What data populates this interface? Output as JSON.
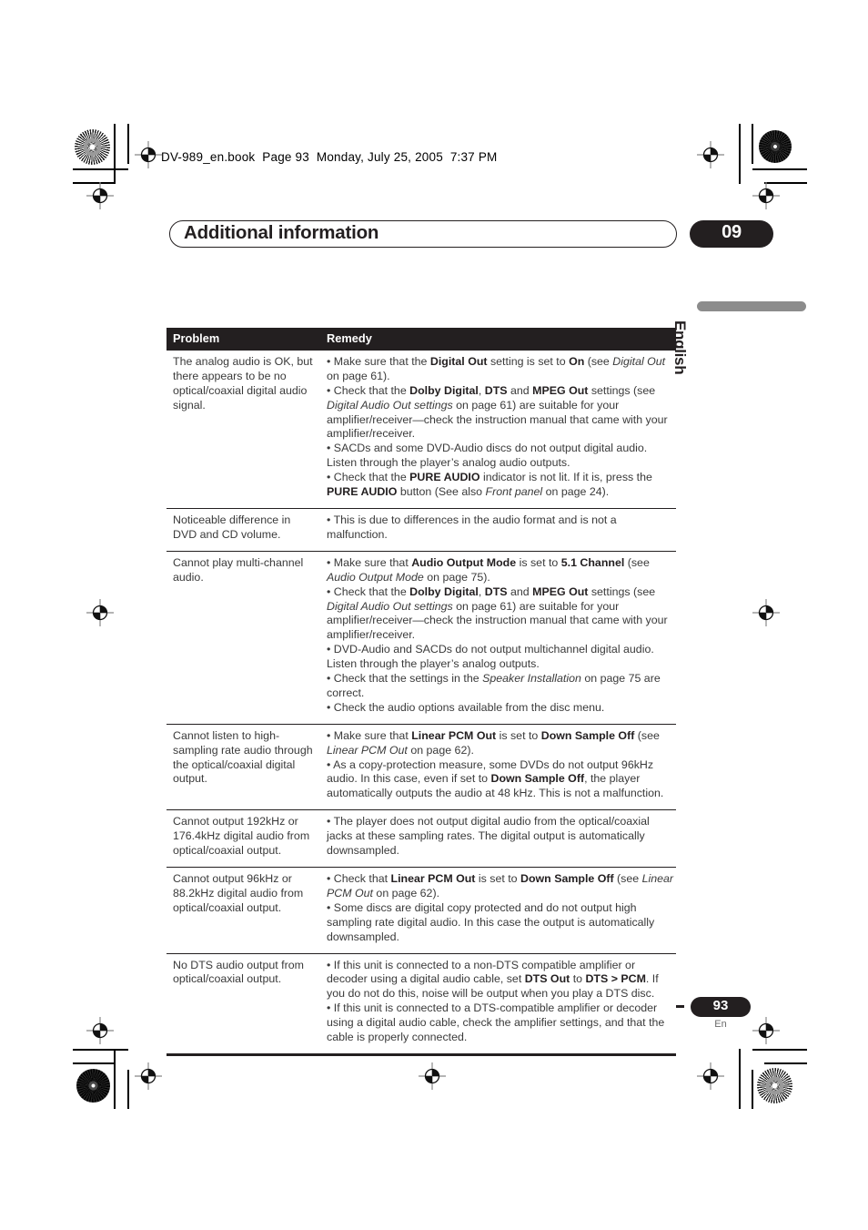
{
  "running_header": "DV-989_en.book  Page 93  Monday, July 25, 2005  7:37 PM",
  "section": {
    "title": "Additional information",
    "chapter_number": "09"
  },
  "side_tab": {
    "language": "English",
    "bar_color": "#8c8c8c"
  },
  "table": {
    "headers": {
      "problem": "Problem",
      "remedy": "Remedy"
    },
    "rows": [
      {
        "problem": "The analog audio is OK, but there appears to be no optical/coaxial digital audio signal.",
        "remedy_html": "<span class=\"bul\">• Make sure that the <b>Digital Out</b> setting is set to <b>On</b> (see <i>Digital Out</i> on page 61).</span><span class=\"bul\">• Check that the <b>Dolby Digital</b>, <b>DTS</b> and <b>MPEG Out</b> settings (see <i>Digital Audio Out settings</i> on page 61) are suitable for your amplifier/receiver—check the instruction manual that came with your amplifier/receiver.</span><span class=\"bul\">• SACDs and some DVD-Audio discs do not output digital audio. Listen through the player&rsquo;s analog audio outputs.</span><span class=\"bul\">• Check that the <b>PURE AUDIO</b> indicator is not lit. If it is, press the <b>PURE AUDIO</b> button (See also <i>Front panel</i> on page 24).</span>"
      },
      {
        "problem": "Noticeable difference in DVD and CD volume.",
        "remedy_html": "<span class=\"bul\">• This is due to differences in the audio format and is not a malfunction.</span>"
      },
      {
        "problem": "Cannot play multi-channel audio.",
        "remedy_html": "<span class=\"bul\">• Make sure that <b>Audio Output Mode</b> is set to <b>5.1 Channel</b> (see <i>Audio Output Mode</i> on page 75).</span><span class=\"bul\">• Check that the <b>Dolby Digital</b>, <b>DTS</b> and <b>MPEG Out</b> settings (see <i>Digital Audio Out settings</i> on page 61) are suitable for your amplifier/receiver—check the instruction manual that came with your amplifier/receiver.</span><span class=\"bul\">• DVD-Audio and SACDs do not output multichannel digital audio. Listen through the player&rsquo;s analog outputs.</span><span class=\"bul\">• Check that the settings in the <i>Speaker Installation</i> on page 75 are correct.</span><span class=\"bul\">• Check the audio options available from the disc menu.</span>"
      },
      {
        "problem": "Cannot listen to high-sampling rate audio through the optical/coaxial digital output.",
        "remedy_html": "<span class=\"bul\">• Make sure that <b>Linear PCM Out</b> is set to <b>Down Sample Off</b> (see <i>Linear PCM Out</i> on page 62).</span><span class=\"bul\">• As a copy-protection measure, some DVDs do not output 96kHz audio. In this case, even if set to <b>Down Sample Off</b>, the player automatically outputs the audio at 48 kHz. This is not a malfunction.</span>"
      },
      {
        "problem": "Cannot output 192kHz or 176.4kHz digital audio from optical/coaxial output.",
        "remedy_html": "<span class=\"bul\">• The player does not output digital audio from the optical/coaxial jacks at these sampling rates. The digital output is automatically downsampled.</span>"
      },
      {
        "problem": "Cannot output 96kHz or 88.2kHz digital audio from optical/coaxial output.",
        "remedy_html": "<span class=\"bul\">• Check that <b>Linear PCM Out</b> is set to <b>Down Sample Off</b> (see <i>Linear PCM Out</i> on page 62).</span><span class=\"bul\">• Some discs are digital copy protected and do not output high sampling rate digital audio. In this case the output is automatically downsampled.</span>"
      },
      {
        "problem": "No DTS audio output from optical/coaxial output.",
        "remedy_html": "<span class=\"bul\">• If this unit is connected to a non-DTS compatible amplifier or decoder using a digital audio cable, set <b>DTS Out</b> to <b>DTS &gt; PCM</b>. If you do not do this, noise will be output when you play a DTS disc.</span><span class=\"bul\">• If this unit is connected to a DTS-compatible amplifier or decoder using a digital audio cable, check the amplifier settings, and that the cable is properly connected.</span>"
      }
    ]
  },
  "footer": {
    "page_number": "93",
    "language_code": "En"
  }
}
